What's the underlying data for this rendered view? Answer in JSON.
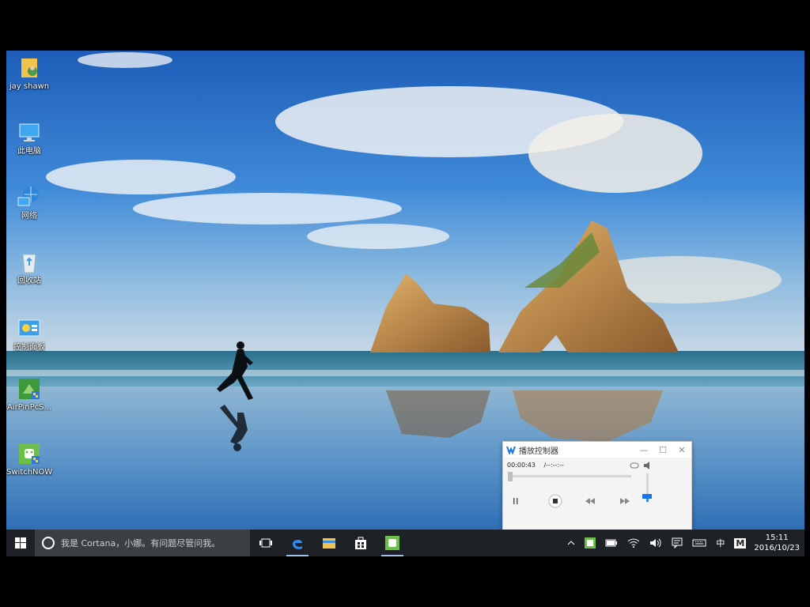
{
  "desktop": {
    "icons": [
      {
        "label": "jay shawn",
        "icon": "user-folder-icon"
      },
      {
        "label": "此电脑",
        "icon": "computer-icon"
      },
      {
        "label": "网络",
        "icon": "network-icon"
      },
      {
        "label": "回收站",
        "icon": "recycle-bin-icon"
      },
      {
        "label": "控制面板",
        "icon": "control-panel-icon"
      },
      {
        "label": "AirPinPcS...",
        "icon": "airpin-shortcut-icon"
      },
      {
        "label": "SwitchNOW",
        "icon": "switchnow-shortcut-icon"
      }
    ]
  },
  "player": {
    "title": "播放控制器",
    "current_time": "00:00:43",
    "total_time": "/--:--:--",
    "minimize": "—",
    "maximize": "☐",
    "close": "✕"
  },
  "taskbar": {
    "search_placeholder": "我是 Cortana，小娜。有问题尽管问我。",
    "apps": [
      "task-view-icon",
      "edge-icon",
      "file-explorer-icon",
      "store-icon",
      "switchnow-taskbar-icon"
    ]
  },
  "tray": {
    "ime": "中",
    "ime_mode": "M",
    "time": "15:11",
    "date": "2016/10/23"
  },
  "colors": {
    "taskbar": "#1e2226",
    "search_box": "#3b3f44",
    "accent": "#1a73e8"
  }
}
